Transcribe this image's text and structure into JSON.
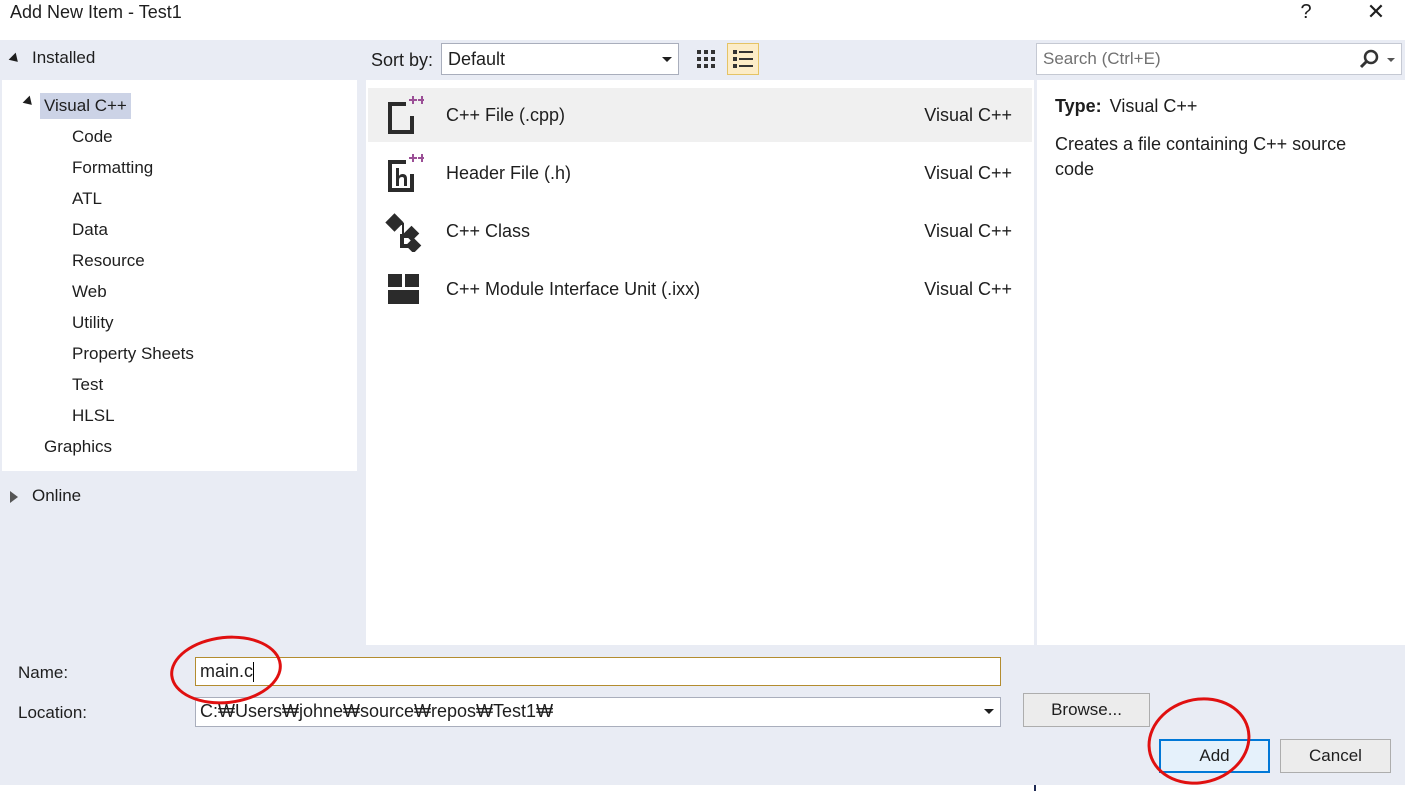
{
  "window": {
    "title": "Add New Item - Test1",
    "help": "?",
    "close": "✕"
  },
  "tree": {
    "installed": "Installed",
    "root": "Visual C++",
    "children": [
      "Code",
      "Formatting",
      "ATL",
      "Data",
      "Resource",
      "Web",
      "Utility",
      "Property Sheets",
      "Test",
      "HLSL"
    ],
    "graphics": "Graphics",
    "online": "Online"
  },
  "sort": {
    "label": "Sort by:",
    "value": "Default"
  },
  "search": {
    "placeholder": "Search (Ctrl+E)"
  },
  "templates": [
    {
      "name": "C++ File (.cpp)",
      "lang": "Visual C++",
      "icon": "cpp-file-icon"
    },
    {
      "name": "Header File (.h)",
      "lang": "Visual C++",
      "icon": "header-file-icon"
    },
    {
      "name": "C++ Class",
      "lang": "Visual C++",
      "icon": "cpp-class-icon"
    },
    {
      "name": "C++ Module Interface Unit (.ixx)",
      "lang": "Visual C++",
      "icon": "module-icon"
    }
  ],
  "description": {
    "type_label": "Type:",
    "type_value": "Visual C++",
    "text": "Creates a file containing C++ source code"
  },
  "form": {
    "name_label": "Name:",
    "name_value": "main.c",
    "location_label": "Location:",
    "location_value": "C:₩Users₩johne₩source₩repos₩Test1₩",
    "browse": "Browse...",
    "add": "Add",
    "cancel": "Cancel"
  },
  "colors": {
    "accent": "#0078d7",
    "annotation": "#e01010",
    "selection": "#ccd3e6",
    "icon_plus": "#9b4f96"
  }
}
